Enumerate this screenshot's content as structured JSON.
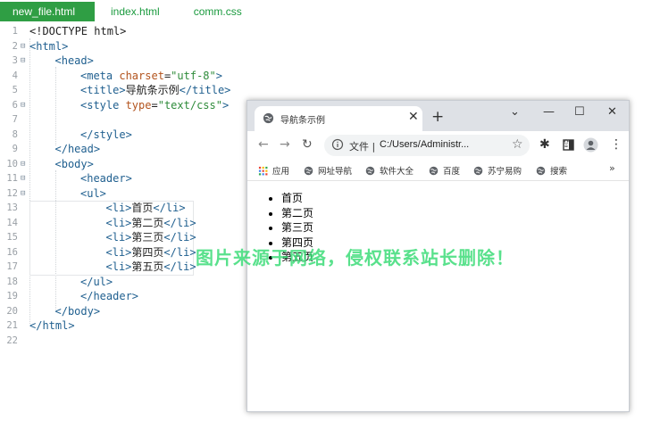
{
  "editor_tabs": [
    {
      "label": "new_file.html",
      "active": true
    },
    {
      "label": "index.html",
      "active": false
    },
    {
      "label": "comm.css",
      "active": false
    }
  ],
  "code_lines": [
    {
      "n": "1",
      "fold": "",
      "indent": 0,
      "segments": [
        {
          "t": "<!DOCTYPE html>",
          "c": "txt"
        }
      ]
    },
    {
      "n": "2",
      "fold": "⊟",
      "indent": 0,
      "segments": [
        {
          "t": "<html>",
          "c": "tag"
        }
      ]
    },
    {
      "n": "3",
      "fold": "⊟",
      "indent": 1,
      "segments": [
        {
          "t": "<head>",
          "c": "tag"
        }
      ]
    },
    {
      "n": "4",
      "fold": "",
      "indent": 2,
      "segments": [
        {
          "t": "<meta ",
          "c": "tag"
        },
        {
          "t": "charset",
          "c": "attr"
        },
        {
          "t": "=",
          "c": "txt"
        },
        {
          "t": "\"utf-8\"",
          "c": "str"
        },
        {
          "t": ">",
          "c": "tag"
        }
      ]
    },
    {
      "n": "5",
      "fold": "",
      "indent": 2,
      "segments": [
        {
          "t": "<title>",
          "c": "tag"
        },
        {
          "t": "导航条示例",
          "c": "txt"
        },
        {
          "t": "</title>",
          "c": "tag"
        }
      ]
    },
    {
      "n": "6",
      "fold": "⊟",
      "indent": 2,
      "segments": [
        {
          "t": "<style ",
          "c": "tag"
        },
        {
          "t": "type",
          "c": "attr"
        },
        {
          "t": "=",
          "c": "txt"
        },
        {
          "t": "\"text/css\"",
          "c": "str"
        },
        {
          "t": ">",
          "c": "tag"
        }
      ]
    },
    {
      "n": "7",
      "fold": "",
      "indent": 0,
      "segments": []
    },
    {
      "n": "8",
      "fold": "",
      "indent": 2,
      "segments": [
        {
          "t": "</style>",
          "c": "tag"
        }
      ]
    },
    {
      "n": "9",
      "fold": "",
      "indent": 1,
      "segments": [
        {
          "t": "</head>",
          "c": "tag"
        }
      ]
    },
    {
      "n": "10",
      "fold": "⊟",
      "indent": 1,
      "segments": [
        {
          "t": "<body>",
          "c": "tag"
        }
      ]
    },
    {
      "n": "11",
      "fold": "⊟",
      "indent": 2,
      "segments": [
        {
          "t": "<header>",
          "c": "tag"
        }
      ]
    },
    {
      "n": "12",
      "fold": "⊟",
      "indent": 2,
      "segments": [
        {
          "t": "<ul>",
          "c": "tag"
        }
      ]
    },
    {
      "n": "13",
      "fold": "",
      "indent": 3,
      "segments": [
        {
          "t": "<li>",
          "c": "tag"
        },
        {
          "t": "首页",
          "c": "txt"
        },
        {
          "t": "</li>",
          "c": "tag"
        }
      ]
    },
    {
      "n": "14",
      "fold": "",
      "indent": 3,
      "segments": [
        {
          "t": "<li>",
          "c": "tag"
        },
        {
          "t": "第二页",
          "c": "txt"
        },
        {
          "t": "</li>",
          "c": "tag"
        }
      ]
    },
    {
      "n": "15",
      "fold": "",
      "indent": 3,
      "segments": [
        {
          "t": "<li>",
          "c": "tag"
        },
        {
          "t": "第三页",
          "c": "txt"
        },
        {
          "t": "</li>",
          "c": "tag"
        }
      ]
    },
    {
      "n": "16",
      "fold": "",
      "indent": 3,
      "segments": [
        {
          "t": "<li>",
          "c": "tag"
        },
        {
          "t": "第四页",
          "c": "txt"
        },
        {
          "t": "</li>",
          "c": "tag"
        }
      ]
    },
    {
      "n": "17",
      "fold": "",
      "indent": 3,
      "segments": [
        {
          "t": "<li>",
          "c": "tag"
        },
        {
          "t": "第五页",
          "c": "txt"
        },
        {
          "t": "</li>",
          "c": "tag"
        }
      ]
    },
    {
      "n": "18",
      "fold": "",
      "indent": 2,
      "segments": [
        {
          "t": "</ul>",
          "c": "tag"
        }
      ]
    },
    {
      "n": "19",
      "fold": "",
      "indent": 2,
      "segments": [
        {
          "t": "</header>",
          "c": "tag"
        }
      ]
    },
    {
      "n": "20",
      "fold": "",
      "indent": 1,
      "segments": [
        {
          "t": "</body>",
          "c": "tag"
        }
      ]
    },
    {
      "n": "21",
      "fold": "",
      "indent": 0,
      "segments": [
        {
          "t": "</html>",
          "c": "tag"
        }
      ]
    },
    {
      "n": "22",
      "fold": "",
      "indent": 0,
      "segments": []
    }
  ],
  "browser": {
    "tab_title": "导航条示例",
    "tab_close": "✕",
    "new_tab": "+",
    "window_controls": {
      "dropdown": "⌄",
      "minimize": "—",
      "maximize": "☐",
      "close": "✕"
    },
    "address": {
      "scheme_label": "文件",
      "separator": "|",
      "url": "C:/Users/Administr..."
    },
    "bookmarks": [
      {
        "label": "应用",
        "icon": "apps-grid-icon"
      },
      {
        "label": "网址导航",
        "icon": "globe-icon"
      },
      {
        "label": "软件大全",
        "icon": "globe-icon"
      },
      {
        "label": "百度",
        "icon": "globe-icon"
      },
      {
        "label": "苏宁易购",
        "icon": "globe-icon"
      },
      {
        "label": "搜索",
        "icon": "globe-icon"
      }
    ],
    "bookmarks_more": "»",
    "page_list": [
      "首页",
      "第二页",
      "第三页",
      "第四页",
      "第五页"
    ]
  },
  "watermark": "图片来源于网络，侵权联系站长删除！",
  "colors": {
    "tab_active": "#2f9e44",
    "tag": "#1f5f8f",
    "attr": "#b3541e",
    "string": "#2e8b3a"
  }
}
